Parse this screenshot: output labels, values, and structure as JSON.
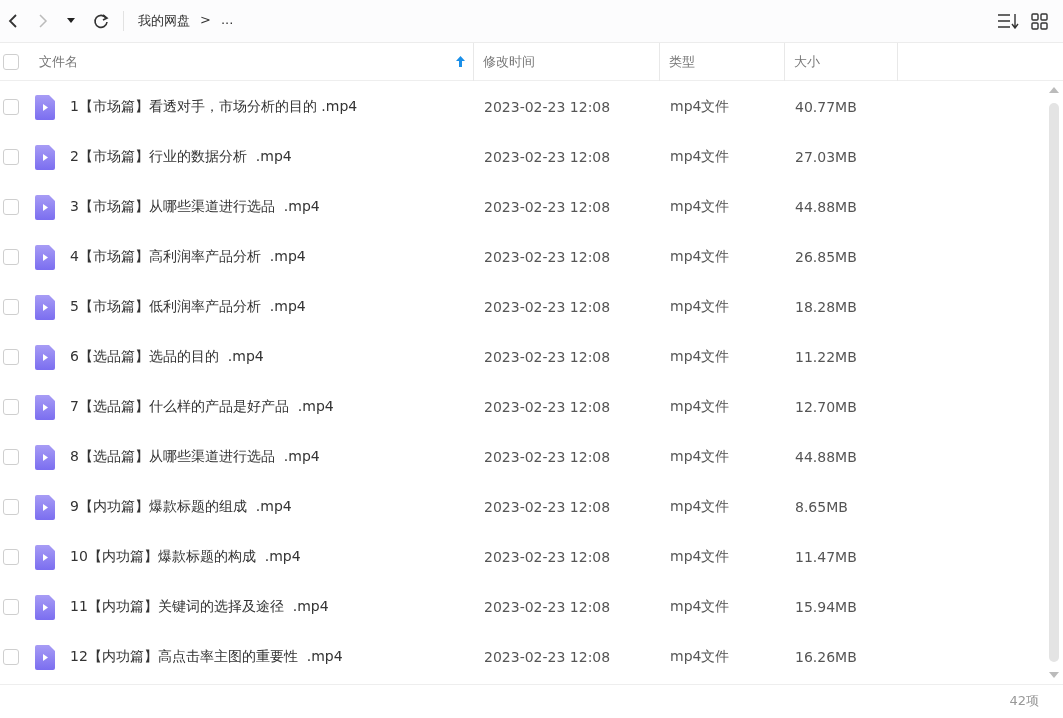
{
  "toolbar": {
    "breadcrumb": [
      {
        "label": "我的网盘"
      },
      {
        "label": ">"
      },
      {
        "label": "..."
      }
    ]
  },
  "table": {
    "select_all": {
      "checked": false
    },
    "columns": [
      {
        "label": "文件名",
        "sorted": true
      },
      {
        "label": "修改时间",
        "sorted": false
      },
      {
        "label": "类型",
        "sorted": false
      },
      {
        "label": "大小",
        "sorted": false
      }
    ],
    "rows": [
      {
        "checked": false,
        "name": "1【市场篇】看透对手，市场分析的目的 .mp4",
        "modified": "2023-02-23 12:08",
        "type": "mp4文件",
        "size": "40.77MB"
      },
      {
        "checked": false,
        "name": "2【市场篇】行业的数据分析  .mp4",
        "modified": "2023-02-23 12:08",
        "type": "mp4文件",
        "size": "27.03MB"
      },
      {
        "checked": false,
        "name": "3【市场篇】从哪些渠道进行选品  .mp4",
        "modified": "2023-02-23 12:08",
        "type": "mp4文件",
        "size": "44.88MB"
      },
      {
        "checked": false,
        "name": "4【市场篇】高利润率产品分析  .mp4",
        "modified": "2023-02-23 12:08",
        "type": "mp4文件",
        "size": "26.85MB"
      },
      {
        "checked": false,
        "name": "5【市场篇】低利润率产品分析  .mp4",
        "modified": "2023-02-23 12:08",
        "type": "mp4文件",
        "size": "18.28MB"
      },
      {
        "checked": false,
        "name": "6【选品篇】选品的目的  .mp4",
        "modified": "2023-02-23 12:08",
        "type": "mp4文件",
        "size": "11.22MB"
      },
      {
        "checked": false,
        "name": "7【选品篇】什么样的产品是好产品  .mp4",
        "modified": "2023-02-23 12:08",
        "type": "mp4文件",
        "size": "12.70MB"
      },
      {
        "checked": false,
        "name": "8【选品篇】从哪些渠道进行选品  .mp4",
        "modified": "2023-02-23 12:08",
        "type": "mp4文件",
        "size": "44.88MB"
      },
      {
        "checked": false,
        "name": "9【内功篇】爆款标题的组成  .mp4",
        "modified": "2023-02-23 12:08",
        "type": "mp4文件",
        "size": "8.65MB"
      },
      {
        "checked": false,
        "name": "10【内功篇】爆款标题的构成  .mp4",
        "modified": "2023-02-23 12:08",
        "type": "mp4文件",
        "size": "11.47MB"
      },
      {
        "checked": false,
        "name": "11【内功篇】关键词的选择及途径  .mp4",
        "modified": "2023-02-23 12:08",
        "type": "mp4文件",
        "size": "15.94MB"
      },
      {
        "checked": false,
        "name": "12【内功篇】高点击率主图的重要性  .mp4",
        "modified": "2023-02-23 12:08",
        "type": "mp4文件",
        "size": "16.26MB"
      }
    ]
  },
  "status_bar": {
    "count": "42项"
  }
}
